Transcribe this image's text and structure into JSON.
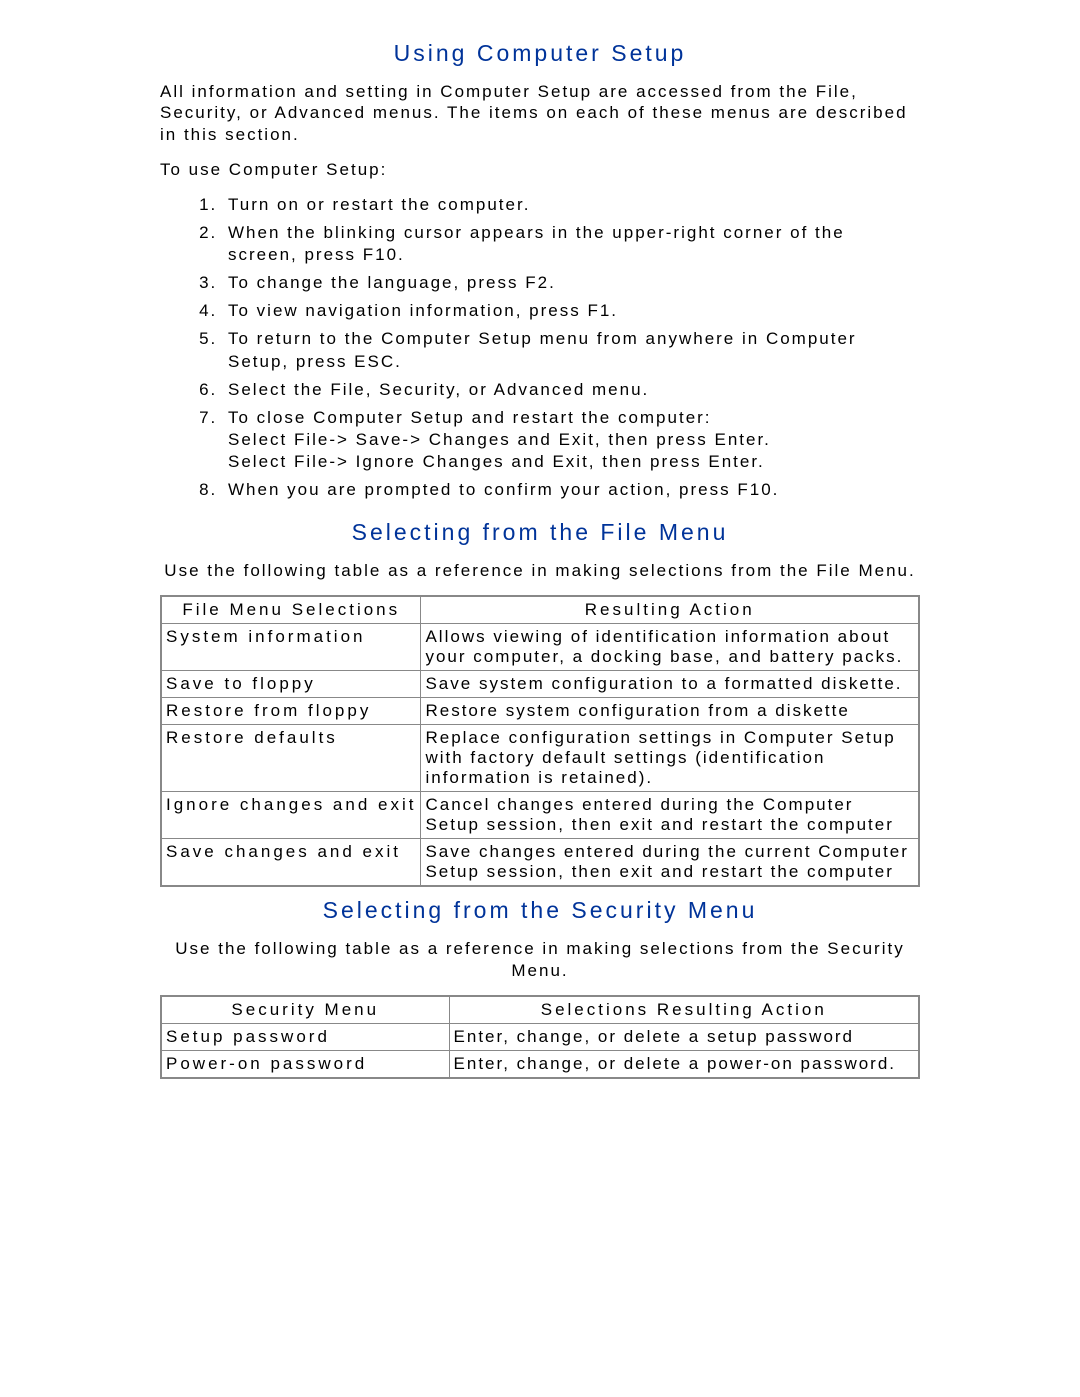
{
  "section1": {
    "title": "Using Computer Setup",
    "intro": "All information and setting in Computer Setup are accessed from the File, Security, or Advanced menus. The items on each of these menus are described in this section.",
    "lead": "To use Computer Setup:",
    "steps": [
      "Turn on or restart the computer.",
      "When the blinking cursor appears in the upper-right corner of the screen, press F10.",
      "To change the language, press F2.",
      "To view navigation information, press F1.",
      "To return to the Computer Setup menu from anywhere in Computer Setup, press ESC.",
      "Select the File, Security, or Advanced menu.",
      "To close Computer Setup and restart the computer:\nSelect File-> Save-> Changes and Exit, then press Enter.\nSelect File-> Ignore Changes and Exit, then press Enter.",
      "When you are prompted to confirm your action, press F10."
    ]
  },
  "section2": {
    "title": "Selecting from the File Menu",
    "intro": "Use the following table as a reference in making selections from the File Menu.",
    "table": {
      "head": [
        "File Menu Selections",
        "Resulting Action"
      ],
      "rows": [
        [
          "System information",
          "Allows viewing of identification information about your computer, a docking base, and battery packs."
        ],
        [
          "Save to floppy",
          "Save system configuration to a formatted diskette."
        ],
        [
          "Restore from floppy",
          "Restore system configuration from a diskette"
        ],
        [
          "Restore defaults",
          "Replace configuration settings in Computer Setup with factory default settings (identification information is retained)."
        ],
        [
          "Ignore changes and exit",
          "Cancel changes entered during the Computer Setup session, then exit and restart the computer"
        ],
        [
          "Save changes and exit",
          "Save changes entered during the current Computer Setup session, then exit and restart the computer"
        ]
      ]
    }
  },
  "section3": {
    "title": "Selecting from the Security Menu",
    "intro": "Use the following table as a reference in making selections from the Security Menu.",
    "table": {
      "head": [
        "Security Menu",
        "Selections Resulting Action"
      ],
      "rows": [
        [
          "Setup password",
          "Enter, change, or delete a setup password"
        ],
        [
          "Power-on password",
          "Enter, change, or delete a power-on password."
        ]
      ]
    }
  }
}
